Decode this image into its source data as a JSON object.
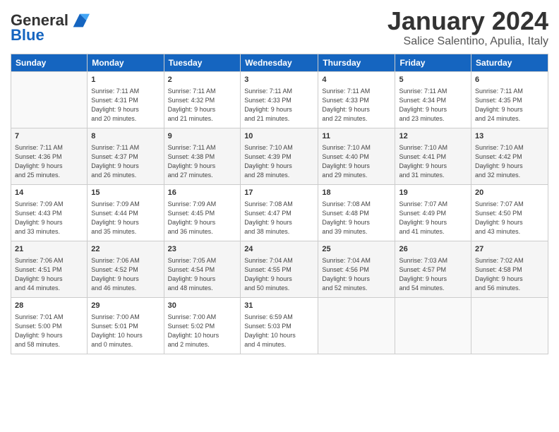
{
  "header": {
    "logo_general": "General",
    "logo_blue": "Blue",
    "title": "January 2024",
    "subtitle": "Salice Salentino, Apulia, Italy"
  },
  "days_of_week": [
    "Sunday",
    "Monday",
    "Tuesday",
    "Wednesday",
    "Thursday",
    "Friday",
    "Saturday"
  ],
  "weeks": [
    [
      {
        "day": "",
        "info": ""
      },
      {
        "day": "1",
        "info": "Sunrise: 7:11 AM\nSunset: 4:31 PM\nDaylight: 9 hours\nand 20 minutes."
      },
      {
        "day": "2",
        "info": "Sunrise: 7:11 AM\nSunset: 4:32 PM\nDaylight: 9 hours\nand 21 minutes."
      },
      {
        "day": "3",
        "info": "Sunrise: 7:11 AM\nSunset: 4:33 PM\nDaylight: 9 hours\nand 21 minutes."
      },
      {
        "day": "4",
        "info": "Sunrise: 7:11 AM\nSunset: 4:33 PM\nDaylight: 9 hours\nand 22 minutes."
      },
      {
        "day": "5",
        "info": "Sunrise: 7:11 AM\nSunset: 4:34 PM\nDaylight: 9 hours\nand 23 minutes."
      },
      {
        "day": "6",
        "info": "Sunrise: 7:11 AM\nSunset: 4:35 PM\nDaylight: 9 hours\nand 24 minutes."
      }
    ],
    [
      {
        "day": "7",
        "info": "Sunrise: 7:11 AM\nSunset: 4:36 PM\nDaylight: 9 hours\nand 25 minutes."
      },
      {
        "day": "8",
        "info": "Sunrise: 7:11 AM\nSunset: 4:37 PM\nDaylight: 9 hours\nand 26 minutes."
      },
      {
        "day": "9",
        "info": "Sunrise: 7:11 AM\nSunset: 4:38 PM\nDaylight: 9 hours\nand 27 minutes."
      },
      {
        "day": "10",
        "info": "Sunrise: 7:10 AM\nSunset: 4:39 PM\nDaylight: 9 hours\nand 28 minutes."
      },
      {
        "day": "11",
        "info": "Sunrise: 7:10 AM\nSunset: 4:40 PM\nDaylight: 9 hours\nand 29 minutes."
      },
      {
        "day": "12",
        "info": "Sunrise: 7:10 AM\nSunset: 4:41 PM\nDaylight: 9 hours\nand 31 minutes."
      },
      {
        "day": "13",
        "info": "Sunrise: 7:10 AM\nSunset: 4:42 PM\nDaylight: 9 hours\nand 32 minutes."
      }
    ],
    [
      {
        "day": "14",
        "info": "Sunrise: 7:09 AM\nSunset: 4:43 PM\nDaylight: 9 hours\nand 33 minutes."
      },
      {
        "day": "15",
        "info": "Sunrise: 7:09 AM\nSunset: 4:44 PM\nDaylight: 9 hours\nand 35 minutes."
      },
      {
        "day": "16",
        "info": "Sunrise: 7:09 AM\nSunset: 4:45 PM\nDaylight: 9 hours\nand 36 minutes."
      },
      {
        "day": "17",
        "info": "Sunrise: 7:08 AM\nSunset: 4:47 PM\nDaylight: 9 hours\nand 38 minutes."
      },
      {
        "day": "18",
        "info": "Sunrise: 7:08 AM\nSunset: 4:48 PM\nDaylight: 9 hours\nand 39 minutes."
      },
      {
        "day": "19",
        "info": "Sunrise: 7:07 AM\nSunset: 4:49 PM\nDaylight: 9 hours\nand 41 minutes."
      },
      {
        "day": "20",
        "info": "Sunrise: 7:07 AM\nSunset: 4:50 PM\nDaylight: 9 hours\nand 43 minutes."
      }
    ],
    [
      {
        "day": "21",
        "info": "Sunrise: 7:06 AM\nSunset: 4:51 PM\nDaylight: 9 hours\nand 44 minutes."
      },
      {
        "day": "22",
        "info": "Sunrise: 7:06 AM\nSunset: 4:52 PM\nDaylight: 9 hours\nand 46 minutes."
      },
      {
        "day": "23",
        "info": "Sunrise: 7:05 AM\nSunset: 4:54 PM\nDaylight: 9 hours\nand 48 minutes."
      },
      {
        "day": "24",
        "info": "Sunrise: 7:04 AM\nSunset: 4:55 PM\nDaylight: 9 hours\nand 50 minutes."
      },
      {
        "day": "25",
        "info": "Sunrise: 7:04 AM\nSunset: 4:56 PM\nDaylight: 9 hours\nand 52 minutes."
      },
      {
        "day": "26",
        "info": "Sunrise: 7:03 AM\nSunset: 4:57 PM\nDaylight: 9 hours\nand 54 minutes."
      },
      {
        "day": "27",
        "info": "Sunrise: 7:02 AM\nSunset: 4:58 PM\nDaylight: 9 hours\nand 56 minutes."
      }
    ],
    [
      {
        "day": "28",
        "info": "Sunrise: 7:01 AM\nSunset: 5:00 PM\nDaylight: 9 hours\nand 58 minutes."
      },
      {
        "day": "29",
        "info": "Sunrise: 7:00 AM\nSunset: 5:01 PM\nDaylight: 10 hours\nand 0 minutes."
      },
      {
        "day": "30",
        "info": "Sunrise: 7:00 AM\nSunset: 5:02 PM\nDaylight: 10 hours\nand 2 minutes."
      },
      {
        "day": "31",
        "info": "Sunrise: 6:59 AM\nSunset: 5:03 PM\nDaylight: 10 hours\nand 4 minutes."
      },
      {
        "day": "",
        "info": ""
      },
      {
        "day": "",
        "info": ""
      },
      {
        "day": "",
        "info": ""
      }
    ]
  ]
}
